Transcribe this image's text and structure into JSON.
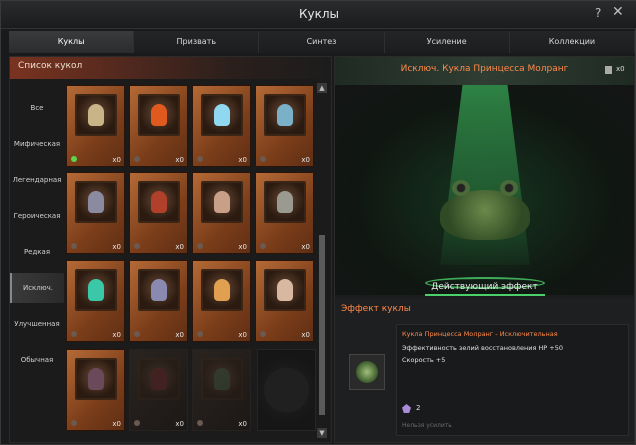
{
  "window": {
    "title": "Куклы",
    "help": "?",
    "close": "✕"
  },
  "tabs": [
    {
      "label": "Куклы",
      "active": true
    },
    {
      "label": "Призвать",
      "active": false
    },
    {
      "label": "Синтез",
      "active": false
    },
    {
      "label": "Усиление",
      "active": false
    },
    {
      "label": "Коллекции",
      "active": false
    }
  ],
  "list": {
    "header": "Список кукол",
    "categories": [
      {
        "label": "Все",
        "active": false
      },
      {
        "label": "Мифическая",
        "active": false
      },
      {
        "label": "Легендарная",
        "active": false
      },
      {
        "label": "Героическая",
        "active": false
      },
      {
        "label": "Редкая",
        "active": false
      },
      {
        "label": "Исключ.",
        "active": true
      },
      {
        "label": "Улучшенная",
        "active": false
      },
      {
        "label": "Обычная",
        "active": false
      }
    ],
    "cards": [
      {
        "count": "x0",
        "color": "#c9b488",
        "pin": "green",
        "dim": false
      },
      {
        "count": "x0",
        "color": "#e05a20",
        "pin": "",
        "dim": false
      },
      {
        "count": "x0",
        "color": "#8fd8f0",
        "pin": "",
        "dim": false
      },
      {
        "count": "x0",
        "color": "#7ab0c8",
        "pin": "",
        "dim": false
      },
      {
        "count": "x0",
        "color": "#8a8aa0",
        "pin": "",
        "dim": false
      },
      {
        "count": "x0",
        "color": "#b0402a",
        "pin": "",
        "dim": false
      },
      {
        "count": "x0",
        "color": "#c8a088",
        "pin": "",
        "dim": false
      },
      {
        "count": "x0",
        "color": "#9a9a90",
        "pin": "",
        "dim": false
      },
      {
        "count": "x0",
        "color": "#3ac8a8",
        "pin": "",
        "dim": false
      },
      {
        "count": "x0",
        "color": "#8a8ab0",
        "pin": "",
        "dim": false
      },
      {
        "count": "x0",
        "color": "#e0a050",
        "pin": "",
        "dim": false
      },
      {
        "count": "x0",
        "color": "#d8b8a0",
        "pin": "",
        "dim": false
      },
      {
        "count": "x0",
        "color": "#6a4a5a",
        "pin": "",
        "dim": false
      },
      {
        "count": "x0",
        "color": "#7a2a2a",
        "pin": "",
        "dim": true
      },
      {
        "count": "x0",
        "color": "#4a6a4a",
        "pin": "",
        "dim": true
      }
    ]
  },
  "detail": {
    "title": "Исключ. Кукла Принцесса Молранг",
    "book_count": "x0",
    "active_effect_caption": "Действующий эффект",
    "effect_label": "Эффект куклы",
    "effect_name": "Кукла Принцесса Молранг - Исключительная",
    "effect_line1": "Эффективность зелий восстановления HP +50",
    "effect_line2": "Скорость +5",
    "crest_count": "2",
    "disabled_note": "Нельзя усилить"
  }
}
